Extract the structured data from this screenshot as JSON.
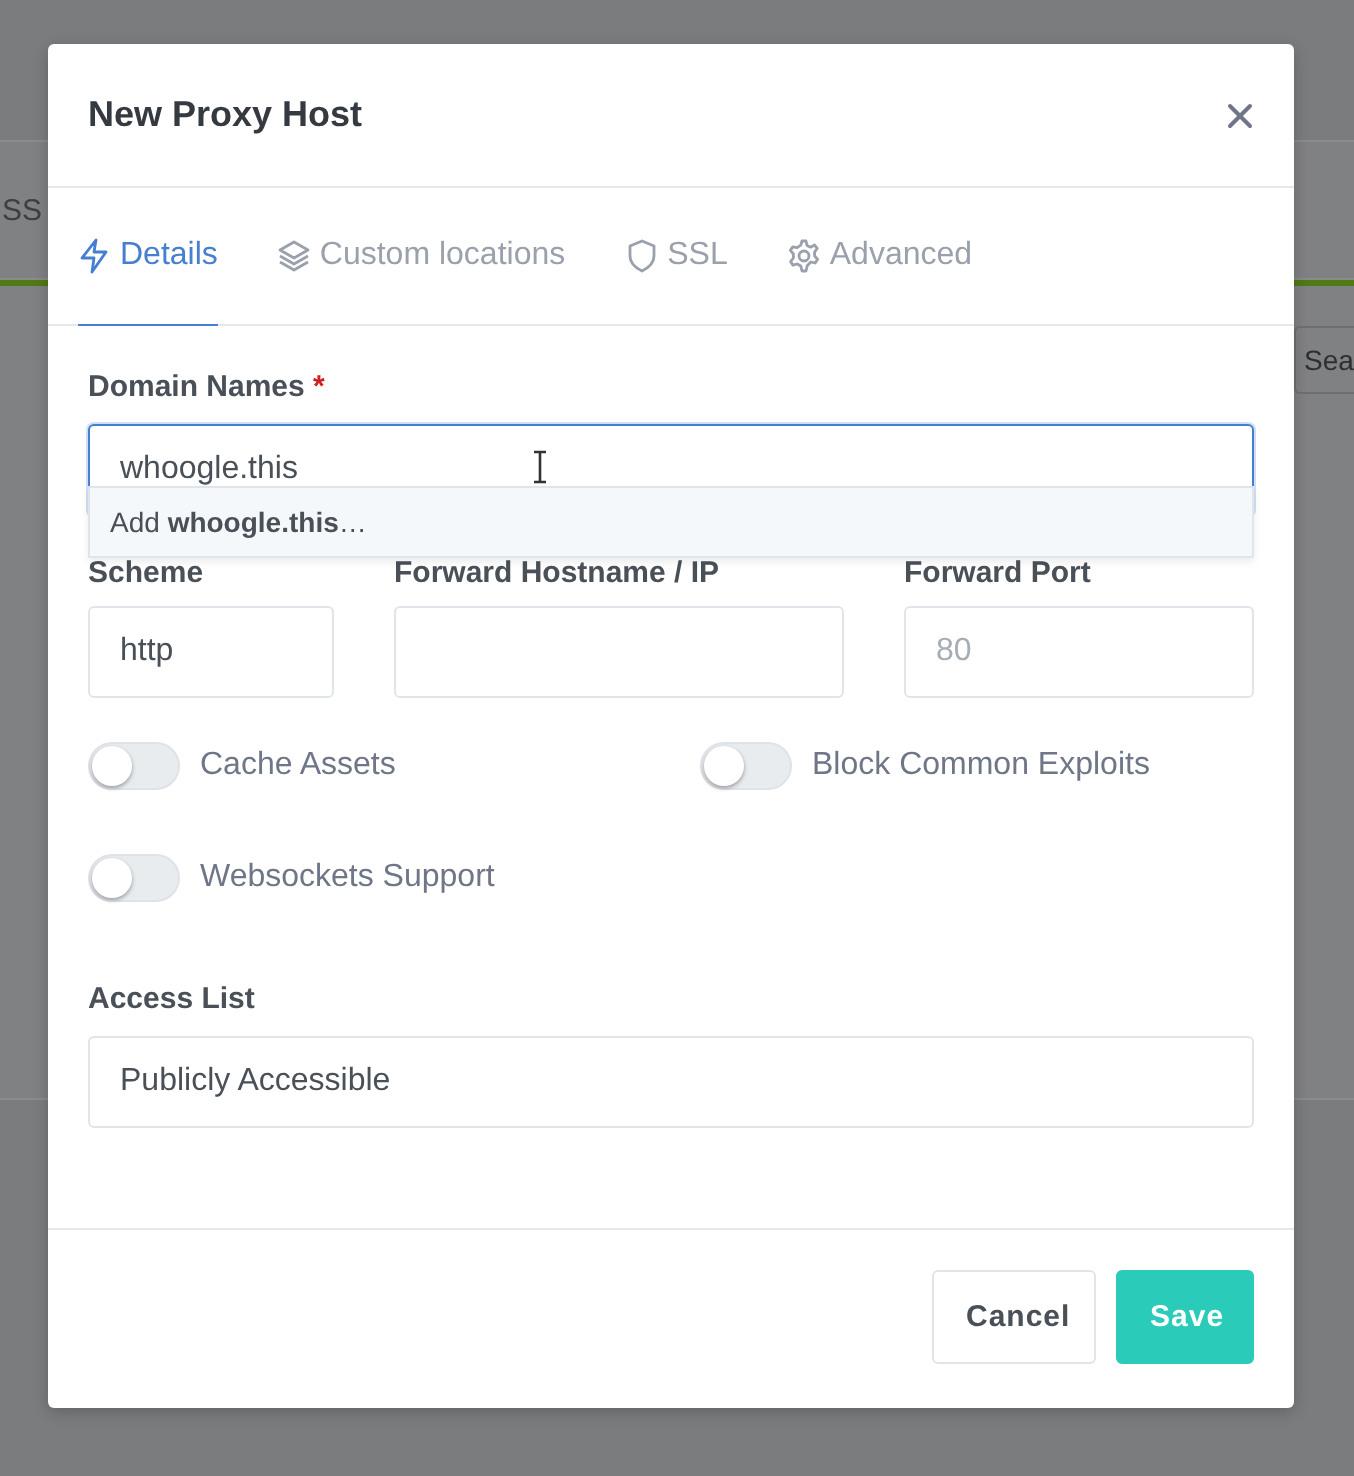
{
  "background_page": {
    "column_label": "SS",
    "search_placeholder": "Sea"
  },
  "dialog": {
    "title": "New Proxy Host",
    "tabs": [
      {
        "label": "Details",
        "selected": true
      },
      {
        "label": "Custom locations",
        "selected": false
      },
      {
        "label": "SSL",
        "selected": false
      },
      {
        "label": "Advanced",
        "selected": false
      }
    ],
    "domain_names": {
      "label": "Domain Names",
      "required_mark": "*",
      "value": "whoogle.this",
      "suggestion": "Add **whoogle.this**…"
    },
    "forward_fields": [
      {
        "label": "Scheme",
        "value": "http"
      },
      {
        "label": "Forward Hostname / IP"
      },
      {
        "label": "Forward Port",
        "placeholder": "80"
      }
    ],
    "toggles": [
      {
        "label": "Cache Assets",
        "on": false
      },
      {
        "label": "Block Common Exploits",
        "on": false
      },
      {
        "label": "Websockets Support",
        "on": false
      }
    ],
    "access_list": {
      "label": "Access List",
      "value": "Publicly Accessible"
    },
    "buttons": [
      {
        "label": "Cancel",
        "kind": "secondary"
      },
      {
        "label": "Save",
        "kind": "primary"
      }
    ]
  }
}
